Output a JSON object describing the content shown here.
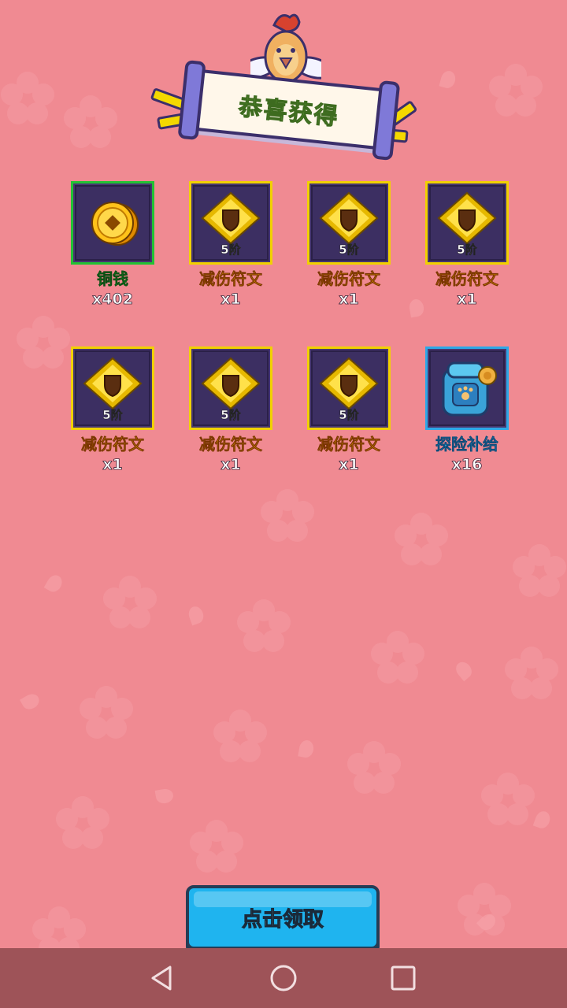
{
  "header": {
    "title": "恭喜获得"
  },
  "rewards": [
    {
      "name": "铜钱",
      "count": "x402",
      "tier": "",
      "rarity": "green",
      "icon": "copper-coin-icon"
    },
    {
      "name": "减伤符文",
      "count": "x1",
      "tier": "5阶",
      "rarity": "gold",
      "icon": "shield-rune-icon"
    },
    {
      "name": "减伤符文",
      "count": "x1",
      "tier": "5阶",
      "rarity": "gold",
      "icon": "shield-rune-icon"
    },
    {
      "name": "减伤符文",
      "count": "x1",
      "tier": "5阶",
      "rarity": "gold",
      "icon": "shield-rune-icon"
    },
    {
      "name": "减伤符文",
      "count": "x1",
      "tier": "5阶",
      "rarity": "gold",
      "icon": "shield-rune-icon"
    },
    {
      "name": "减伤符文",
      "count": "x1",
      "tier": "5阶",
      "rarity": "gold",
      "icon": "shield-rune-icon"
    },
    {
      "name": "减伤符文",
      "count": "x1",
      "tier": "5阶",
      "rarity": "gold",
      "icon": "shield-rune-icon"
    },
    {
      "name": "探险补给",
      "count": "x16",
      "tier": "",
      "rarity": "blue",
      "icon": "backpack-icon"
    }
  ],
  "claim_button": {
    "label": "点击领取"
  },
  "colors": {
    "background": "#f08a92",
    "gold_border": "#f1d100",
    "green_border": "#22c234",
    "blue_border": "#2ea7e6",
    "button": "#1fb4ef"
  },
  "nav": {
    "back": "back-icon",
    "home": "home-icon",
    "recents": "recents-icon"
  }
}
